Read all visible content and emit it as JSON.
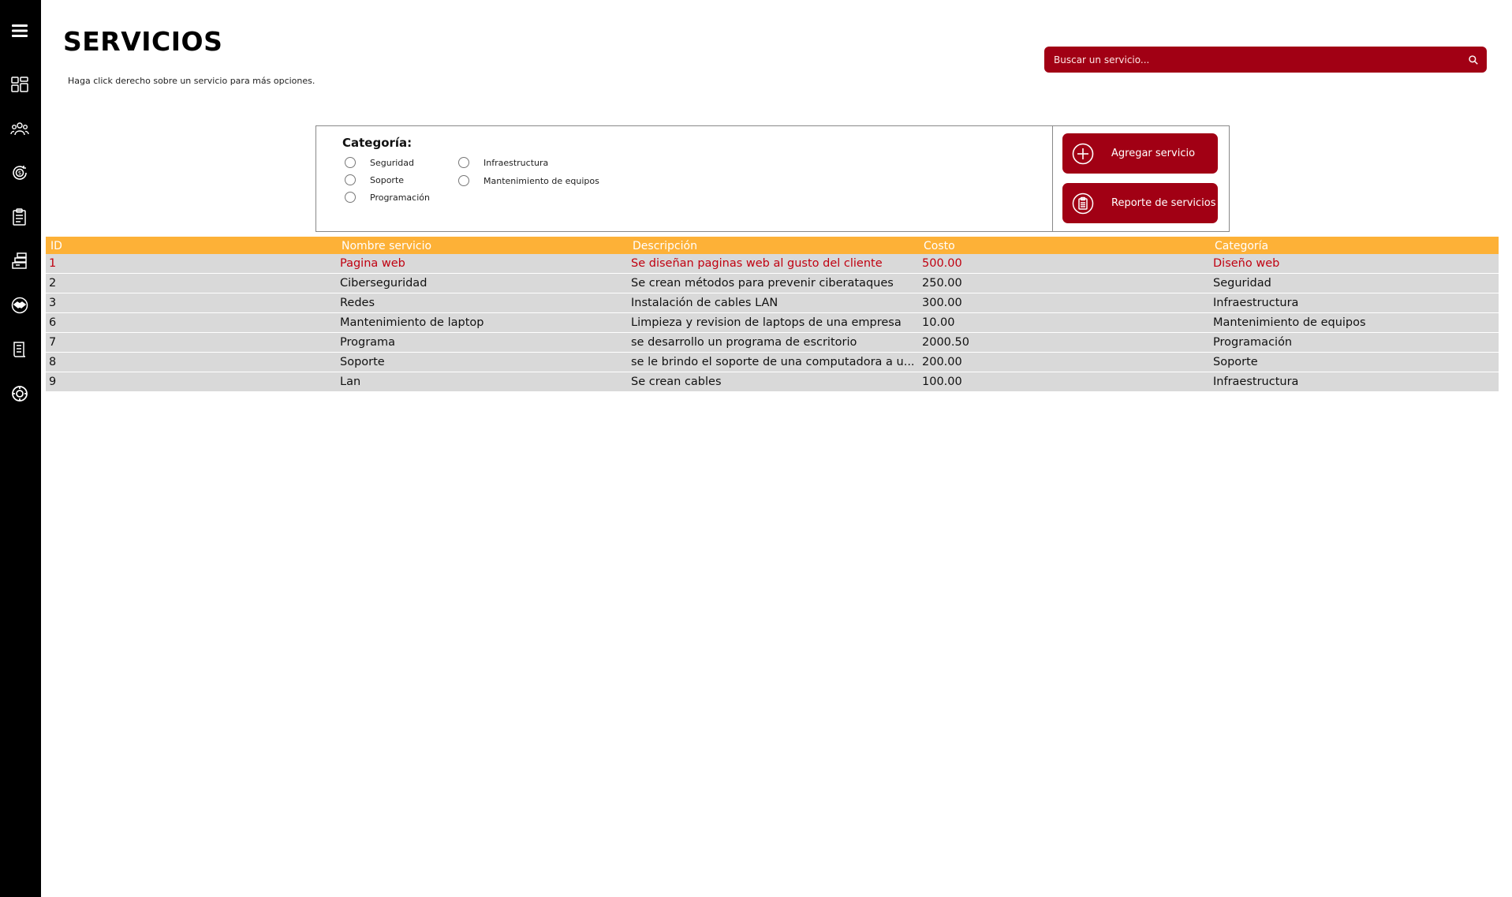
{
  "sidebar": {
    "items": [
      {
        "icon": "hamburger-menu-icon"
      },
      {
        "icon": "dashboard-icon"
      },
      {
        "icon": "users-group-icon"
      },
      {
        "icon": "money-cycle-icon"
      },
      {
        "icon": "clipboard-report-icon"
      },
      {
        "icon": "inventory-stack-icon"
      },
      {
        "icon": "handshake-icon"
      },
      {
        "icon": "receipt-icon"
      },
      {
        "icon": "settings-gear-icon"
      }
    ]
  },
  "header": {
    "title": "SERVICIOS",
    "hint": "Haga click derecho sobre un servicio para más opciones."
  },
  "search": {
    "placeholder": "Buscar un servicio...",
    "icon": "search-icon"
  },
  "filter": {
    "label": "Categoría:",
    "options": [
      "Seguridad",
      "Soporte",
      "Programación",
      "Infraestructura",
      "Mantenimiento de equipos"
    ]
  },
  "actions": {
    "add_label": "Agregar servicio",
    "report_label": "Reporte de servicios"
  },
  "table": {
    "headers": [
      "ID",
      "Nombre servicio",
      "Descripción",
      "Costo",
      "Categoría"
    ],
    "rows": [
      [
        "1",
        "Pagina web",
        "Se diseñan paginas web al gusto del cliente",
        "500.00",
        "Diseño web"
      ],
      [
        "2",
        "Ciberseguridad",
        "Se crean métodos para prevenir ciberataques",
        "250.00",
        "Seguridad"
      ],
      [
        "3",
        "Redes",
        "Instalación de cables LAN",
        "300.00",
        "Infraestructura"
      ],
      [
        "6",
        "Mantenimiento de laptop",
        "Limpieza y revision de laptops de una empresa",
        "10.00",
        "Mantenimiento de equipos"
      ],
      [
        "7",
        "Programa",
        "se desarrollo un programa de escritorio",
        "2000.50",
        "Programación"
      ],
      [
        "8",
        "Soporte",
        "se le brindo el soporte de una computadora a u...",
        "200.00",
        "Soporte"
      ],
      [
        "9",
        "Lan",
        "Se crean cables",
        "100.00",
        "Infraestructura"
      ]
    ],
    "selected_row": 0
  },
  "colors": {
    "accent": "#a10014",
    "header_bg": "#fdb137",
    "row_bg": "#d9d9d9",
    "selected_text": "#c00010",
    "sidebar_bg": "#000000"
  }
}
